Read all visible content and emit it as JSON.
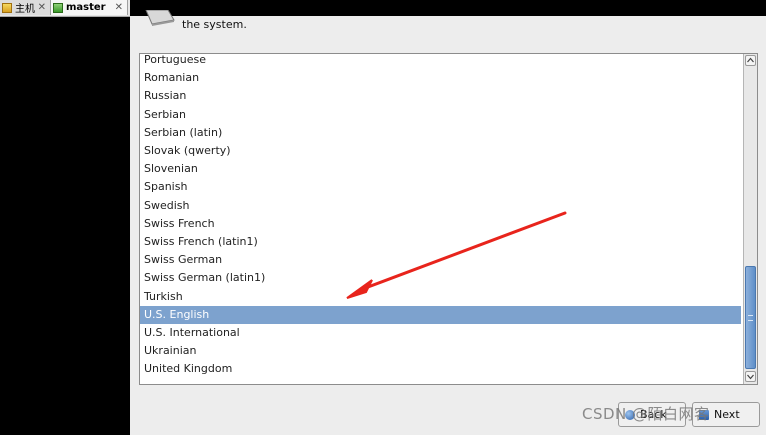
{
  "tabs": [
    {
      "label": "主机",
      "icon": "home-icon"
    },
    {
      "label": "master",
      "icon": "vm-icon"
    }
  ],
  "header": {
    "text": "the system."
  },
  "languages": [
    "Portuguese",
    "Romanian",
    "Russian",
    "Serbian",
    "Serbian (latin)",
    "Slovak (qwerty)",
    "Slovenian",
    "Spanish",
    "Swedish",
    "Swiss French",
    "Swiss French (latin1)",
    "Swiss German",
    "Swiss German (latin1)",
    "Turkish",
    "U.S. English",
    "U.S. International",
    "Ukrainian",
    "United Kingdom"
  ],
  "selected_language": "U.S. English",
  "buttons": {
    "back": "Back",
    "next": "Next"
  },
  "watermark": "CSDN @陌白网客",
  "colors": {
    "selection": "#7da2ce",
    "annotation_arrow": "#e8241c"
  }
}
